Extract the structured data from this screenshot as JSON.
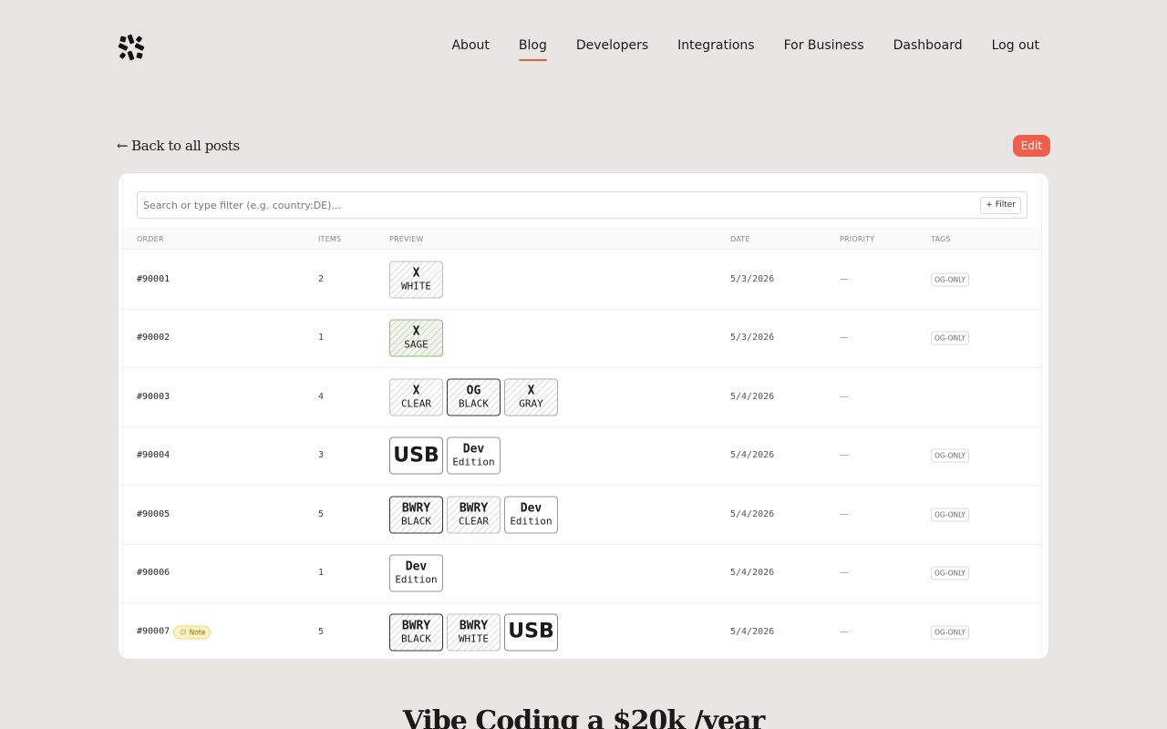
{
  "nav": {
    "items": [
      {
        "label": "About",
        "active": false
      },
      {
        "label": "Blog",
        "active": true
      },
      {
        "label": "Developers",
        "active": false
      },
      {
        "label": "Integrations",
        "active": false
      },
      {
        "label": "For Business",
        "active": false
      },
      {
        "label": "Dashboard",
        "active": false
      },
      {
        "label": "Log out",
        "active": false
      }
    ]
  },
  "back_link": {
    "arrow": "←",
    "label": "Back to all posts"
  },
  "edit_label": "Edit",
  "search": {
    "placeholder": "Search or type filter (e.g. country:DE)...",
    "value": ""
  },
  "filter_label": "+ Filter",
  "table": {
    "headers": {
      "order": "ORDER",
      "items": "ITEMS",
      "preview": "PREVIEW",
      "date": "DATE",
      "priority": "PRIORITY",
      "tags": "TAGS"
    },
    "rows": [
      {
        "order": "#90001",
        "note": "",
        "items": "2",
        "preview": [
          {
            "line1": "X",
            "line2": "WHITE",
            "style": "hatch"
          }
        ],
        "date": "5/3/2026",
        "priority": "—",
        "tag": "OG-ONLY"
      },
      {
        "order": "#90002",
        "note": "",
        "items": "1",
        "preview": [
          {
            "line1": "X",
            "line2": "SAGE",
            "style": "hatch sage"
          }
        ],
        "date": "5/3/2026",
        "priority": "—",
        "tag": "OG-ONLY"
      },
      {
        "order": "#90003",
        "note": "",
        "items": "4",
        "preview": [
          {
            "line1": "X",
            "line2": "CLEAR",
            "style": "hatch"
          },
          {
            "line1": "OG",
            "line2": "BLACK",
            "style": "hatch dark"
          },
          {
            "line1": "X",
            "line2": "GRAY",
            "style": "hatch gray"
          }
        ],
        "date": "5/4/2026",
        "priority": "—",
        "tag": ""
      },
      {
        "order": "#90004",
        "note": "",
        "items": "3",
        "preview": [
          {
            "line1": "USB",
            "line2": "",
            "style": "big"
          },
          {
            "line1": "Dev",
            "line2": "Edition",
            "style": "dev"
          }
        ],
        "date": "5/4/2026",
        "priority": "—",
        "tag": "OG-ONLY"
      },
      {
        "order": "#90005",
        "note": "",
        "items": "5",
        "preview": [
          {
            "line1": "BWRY",
            "line2": "BLACK",
            "style": "hatch dark"
          },
          {
            "line1": "BWRY",
            "line2": "CLEAR",
            "style": "hatch"
          },
          {
            "line1": "Dev",
            "line2": "Edition",
            "style": "dev"
          }
        ],
        "date": "5/4/2026",
        "priority": "—",
        "tag": "OG-ONLY"
      },
      {
        "order": "#90006",
        "note": "",
        "items": "1",
        "preview": [
          {
            "line1": "Dev",
            "line2": "Edition",
            "style": "dev"
          }
        ],
        "date": "5/4/2026",
        "priority": "—",
        "tag": "OG-ONLY"
      },
      {
        "order": "#90007",
        "note": "Note",
        "items": "5",
        "preview": [
          {
            "line1": "BWRY",
            "line2": "BLACK",
            "style": "hatch dark"
          },
          {
            "line1": "BWRY",
            "line2": "WHITE",
            "style": "hatch"
          },
          {
            "line1": "USB",
            "line2": "",
            "style": "big"
          }
        ],
        "date": "5/4/2026",
        "priority": "—",
        "tag": "OG-ONLY"
      }
    ]
  },
  "headline": "Vibe Coding a $20k /year",
  "colors": {
    "accent": "#ef5f4b",
    "background": "#e8e6e3"
  },
  "icons": {
    "logo": "logo-icon",
    "note": "comment-icon"
  }
}
